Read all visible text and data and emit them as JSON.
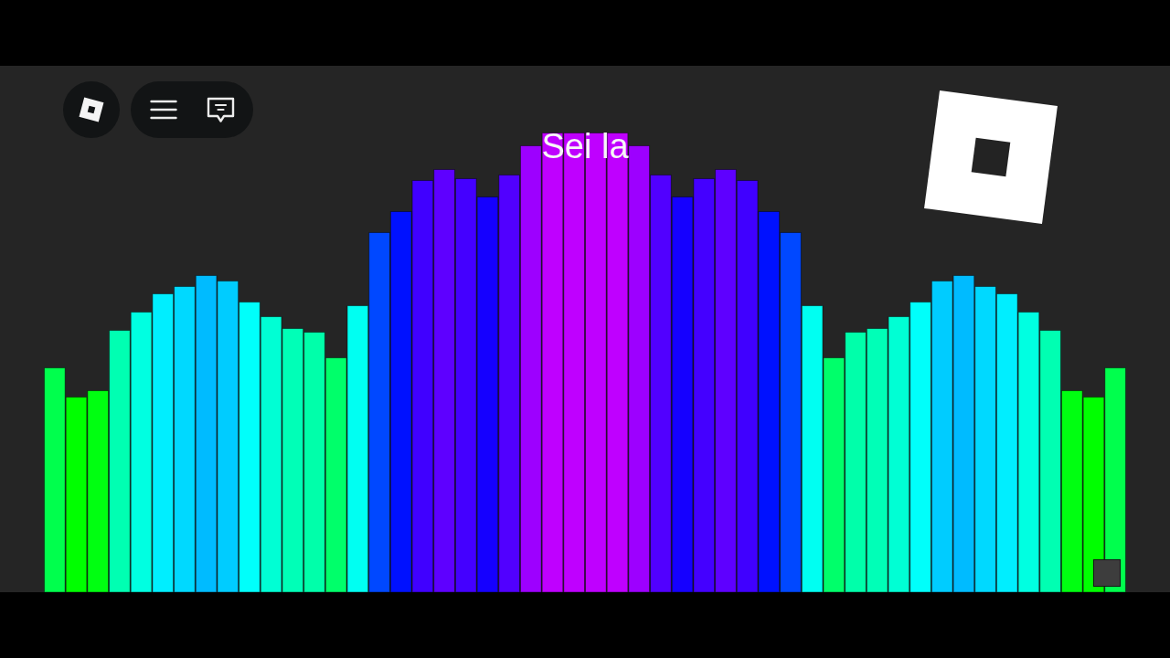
{
  "stage": {
    "caption": "Sei la"
  }
}
